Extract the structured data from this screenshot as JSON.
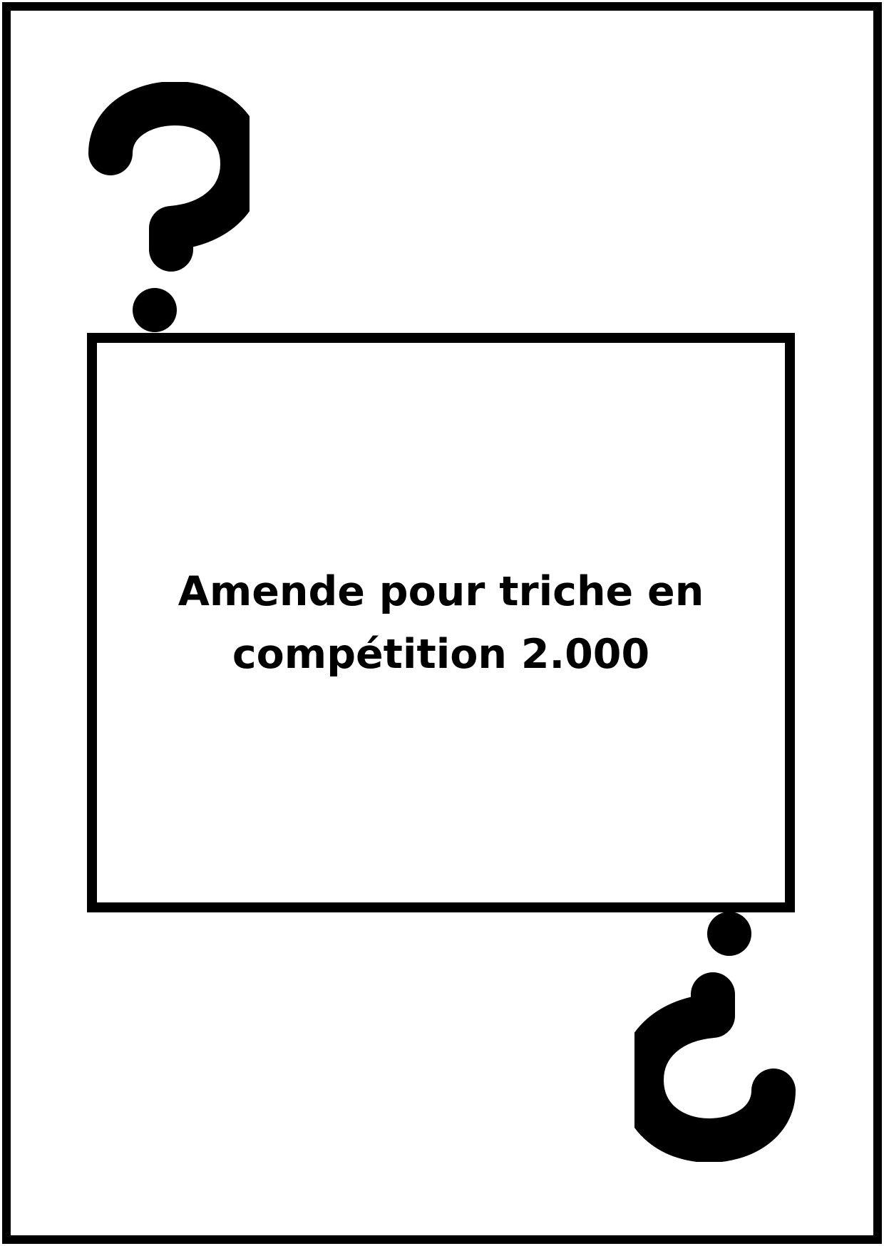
{
  "card": {
    "text": "Amende pour triche en compétition 2.000",
    "symbol_top": "question-mark-icon",
    "symbol_bottom": "inverted-question-mark-icon",
    "colors": {
      "ink": "#000000",
      "background": "#ffffff"
    }
  }
}
